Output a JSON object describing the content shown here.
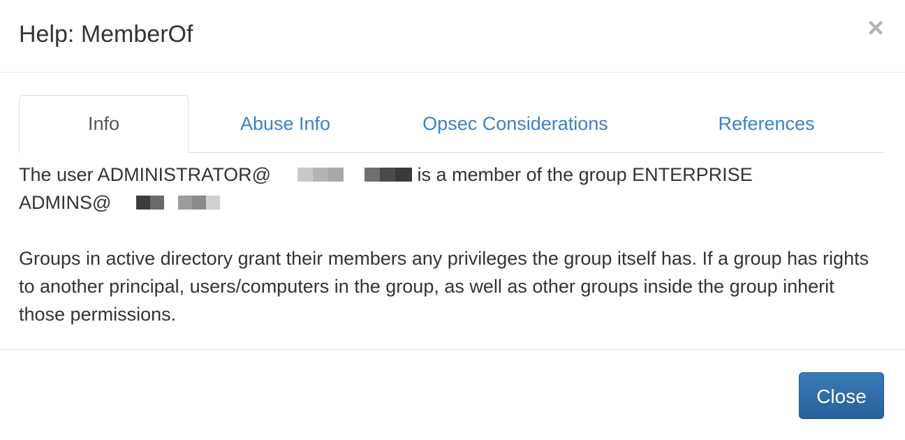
{
  "modal": {
    "title": "Help: MemberOf",
    "close_glyph": "×"
  },
  "tabs": [
    {
      "label": "Info",
      "active": true
    },
    {
      "label": "Abuse Info",
      "active": false
    },
    {
      "label": "Opsec Considerations",
      "active": false
    },
    {
      "label": "References",
      "active": false
    }
  ],
  "info": {
    "sentence_prefix": "The user ADMINISTRATOR@",
    "sentence_middle": " is a member of the group ENTERPRISE",
    "second_line_prefix": "ADMINS@",
    "paragraph": "Groups in active directory grant their members any privileges the group itself has. If a group has rights to another principal, users/computers in the group, as well as other groups inside the group inherit those permissions."
  },
  "footer": {
    "close_label": "Close"
  },
  "colors": {
    "link": "#3c82c4",
    "primary_button": "#2c6aa5",
    "redaction_dark": "#555555",
    "redaction_light": "#b0b0b0"
  }
}
